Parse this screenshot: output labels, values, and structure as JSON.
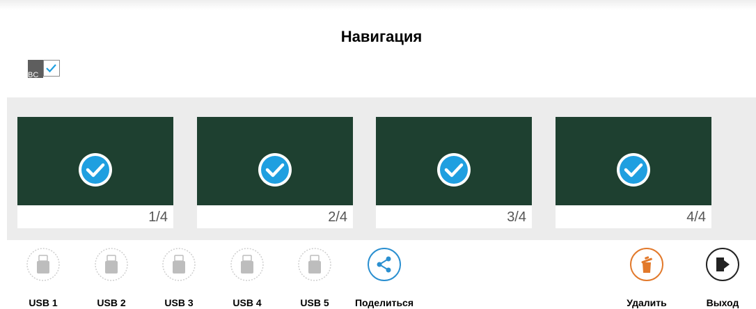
{
  "header": {
    "title": "Навигация",
    "select_all_abbr": "BC"
  },
  "pages": [
    {
      "label": "1/4",
      "selected": true
    },
    {
      "label": "2/4",
      "selected": true
    },
    {
      "label": "3/4",
      "selected": true
    },
    {
      "label": "4/4",
      "selected": true
    }
  ],
  "toolbar": {
    "usb": [
      {
        "label": "USB 1",
        "icon": "usb-drive-icon",
        "enabled": false
      },
      {
        "label": "USB 2",
        "icon": "usb-drive-icon",
        "enabled": false
      },
      {
        "label": "USB 3",
        "icon": "usb-drive-icon",
        "enabled": false
      },
      {
        "label": "USB 4",
        "icon": "usb-drive-icon",
        "enabled": false
      },
      {
        "label": "USB 5",
        "icon": "usb-drive-icon",
        "enabled": false
      }
    ],
    "share_label": "Поделиться",
    "delete_label": "Удалить",
    "exit_label": "Выход"
  },
  "colors": {
    "thumbnail_bg": "#1e4030",
    "check_blue": "#1f9fe0",
    "share_blue": "#2a8fd0",
    "delete_orange": "#e2792b",
    "exit_dark": "#222222",
    "usb_disabled": "#bdbdbd"
  }
}
